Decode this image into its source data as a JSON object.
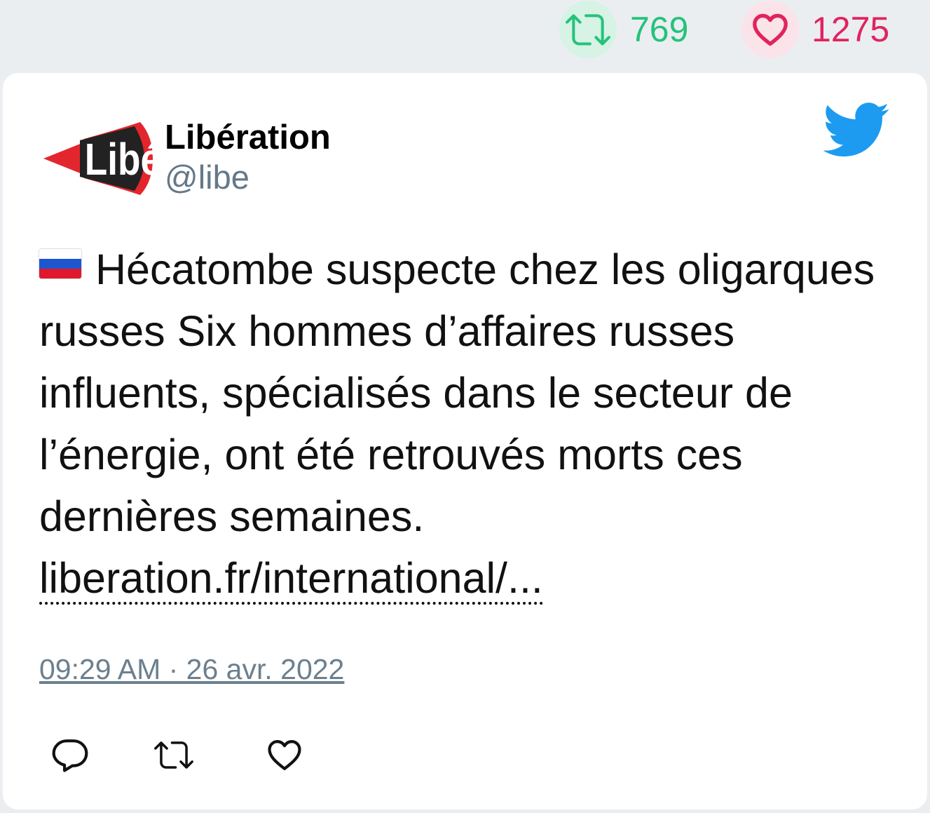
{
  "stats": {
    "retweet_count": "769",
    "like_count": "1275",
    "retweet_color": "#25c27b",
    "like_color": "#e0245e"
  },
  "tweet": {
    "author_name": "Libération",
    "author_handle": "@libe",
    "avatar_text": "Libé",
    "flag": "russia-flag-emoji",
    "text": "Hécatombe suspecte chez les oligarques russes Six hommes d’affaires russes influents, spécialisés dans le secteur de l’énergie, ont été retrouvés morts ces dernières semaines.",
    "link_text": "liberation.fr/international/...",
    "timestamp": "09:29 AM · 26 avr. 2022"
  },
  "actions": {
    "reply_icon": "reply-icon",
    "retweet_icon": "retweet-icon",
    "like_icon": "heart-icon"
  },
  "brand": {
    "twitter_blue": "#1d9bf0",
    "logo": "twitter-bird-icon"
  }
}
